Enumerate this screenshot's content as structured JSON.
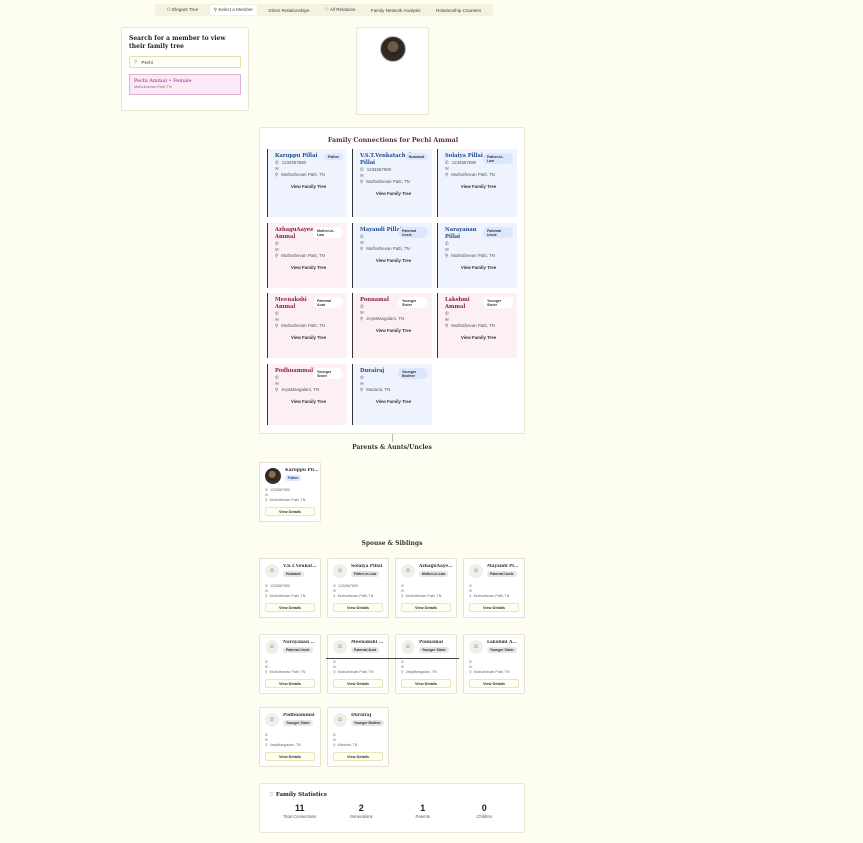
{
  "tabs": [
    {
      "icon": "⚇",
      "label": "Elegant Tree"
    },
    {
      "icon": "⚲",
      "label": "Select a Member"
    },
    {
      "icon": "",
      "label": "Direct Relationships"
    },
    {
      "icon": "♡",
      "label": "All Relations"
    },
    {
      "icon": "",
      "label": "Family Network Analysis"
    },
    {
      "icon": "",
      "label": "Relationship Counters"
    }
  ],
  "search": {
    "title": "Search for a member to view their family tree",
    "value": "Pechi",
    "result_name": "Pechi Ammal • Female",
    "result_location": "Muthuthevan Patti, TN"
  },
  "connections": {
    "title": "Family Connections for Pechi Ammal",
    "cards": [
      {
        "name": "Karuppu Pillai",
        "relation": "Father",
        "gender": "male",
        "phone": "1234567890",
        "email": "",
        "location": "Muthuthevan Patti, TN",
        "button": "View Family Tree"
      },
      {
        "name": "V.S.T.Venkatachalam Pillai",
        "relation": "Husband",
        "gender": "male",
        "phone": "1234567890",
        "email": "",
        "location": "Muthuthevan Patti, TN",
        "button": "View Family Tree"
      },
      {
        "name": "Solaiya Pillai",
        "relation": "Father-in-Law",
        "gender": "male",
        "phone": "1234567890",
        "email": "",
        "location": "Muthuthevan Patti, TN",
        "button": "View Family Tree"
      },
      {
        "name": "AzhaguAayee Ammal",
        "relation": "Mother-in-Law",
        "gender": "female",
        "phone": "",
        "email": "",
        "location": "Muthuthevan Patti, TN",
        "button": "View Family Tree"
      },
      {
        "name": "Mayandi Pillai",
        "relation": "Paternal Uncle",
        "gender": "male",
        "phone": "",
        "email": "",
        "location": "Muthuthevan Patti, TN",
        "button": "View Family Tree"
      },
      {
        "name": "Narayanan Pillai",
        "relation": "Paternal Uncle",
        "gender": "male",
        "phone": "",
        "email": "",
        "location": "Muthuthevan Patti, TN",
        "button": "View Family Tree"
      },
      {
        "name": "Meenakshi Ammal",
        "relation": "Paternal Aunt",
        "gender": "female",
        "phone": "",
        "email": "",
        "location": "Muthuthevan Patti, TN",
        "button": "View Family Tree"
      },
      {
        "name": "Ponnamal",
        "relation": "Younger Sister",
        "gender": "female",
        "phone": "",
        "email": "",
        "location": "JeyaMangalam, TN",
        "button": "View Family Tree"
      },
      {
        "name": "Lakshmi Ammal",
        "relation": "Younger Sister",
        "gender": "female",
        "phone": "",
        "email": "",
        "location": "Muthuthevan Patti, TN",
        "button": "View Family Tree"
      },
      {
        "name": "Podhuammal",
        "relation": "Younger Sister",
        "gender": "female",
        "phone": "",
        "email": "",
        "location": "JeyaMangalam, TN",
        "button": "View Family Tree"
      },
      {
        "name": "Durairaj",
        "relation": "Younger Brother",
        "gender": "male",
        "phone": "",
        "email": "",
        "location": "Madurai, TN",
        "button": "View Family Tree"
      }
    ]
  },
  "parents_section": {
    "title": "Parents & Aunts/Uncles",
    "cards": [
      {
        "name": "Karuppu Pil...",
        "relation": "Father",
        "phone": "1234567890",
        "email": "",
        "location": "Muthuthevan Patti, TN",
        "button": "View Details"
      }
    ]
  },
  "siblings_section": {
    "title": "Spouse & Siblings",
    "cards": [
      {
        "name": "V.S.T.Venkat...",
        "relation": "Husband",
        "phone": "1234567890",
        "email": "",
        "location": "Muthuthevan Patti, TN",
        "button": "View Details"
      },
      {
        "name": "Solaiya Pillai",
        "relation": "Father-in-Law",
        "phone": "1234567890",
        "email": "",
        "location": "Muthuthevan Patti, TN",
        "button": "View Details"
      },
      {
        "name": "AzhaguAaye...",
        "relation": "Mother-in-Law",
        "phone": "",
        "email": "",
        "location": "Muthuthevan Patti, TN",
        "button": "View Details"
      },
      {
        "name": "Mayandi Pi...",
        "relation": "Paternal Uncle",
        "phone": "",
        "email": "",
        "location": "Muthuthevan Patti, TN",
        "button": "View Details"
      },
      {
        "name": "Narayanan ...",
        "relation": "Paternal Uncle",
        "phone": "",
        "email": "",
        "location": "Muthuthevan Patti, TN",
        "button": "View Details"
      },
      {
        "name": "Meenakshi ...",
        "relation": "Paternal Aunt",
        "phone": "",
        "email": "",
        "location": "Muthuthevan Patti, TN",
        "button": "View Details"
      },
      {
        "name": "Ponnamal",
        "relation": "Younger Sister",
        "phone": "",
        "email": "",
        "location": "JeyaMangalam, TN",
        "button": "View Details"
      },
      {
        "name": "Lakshmi A...",
        "relation": "Younger Sister",
        "phone": "",
        "email": "",
        "location": "Muthuthevan Patti, TN",
        "button": "View Details"
      },
      {
        "name": "Podhuammal",
        "relation": "Younger Sister",
        "phone": "",
        "email": "",
        "location": "JeyaMangalam, TN",
        "button": "View Details"
      },
      {
        "name": "Durairaj",
        "relation": "Younger Brother",
        "phone": "",
        "email": "",
        "location": "Madurai, TN",
        "button": "View Details"
      }
    ]
  },
  "stats": {
    "title": "Family Statistics",
    "items": [
      {
        "value": "11",
        "label": "Total Connections"
      },
      {
        "value": "2",
        "label": "Generations"
      },
      {
        "value": "1",
        "label": "Parents"
      },
      {
        "value": "0",
        "label": "Children"
      }
    ]
  },
  "icons": {
    "phone": "✆",
    "email": "✉",
    "location": "⚲",
    "heart": "♡",
    "person": "☺"
  }
}
